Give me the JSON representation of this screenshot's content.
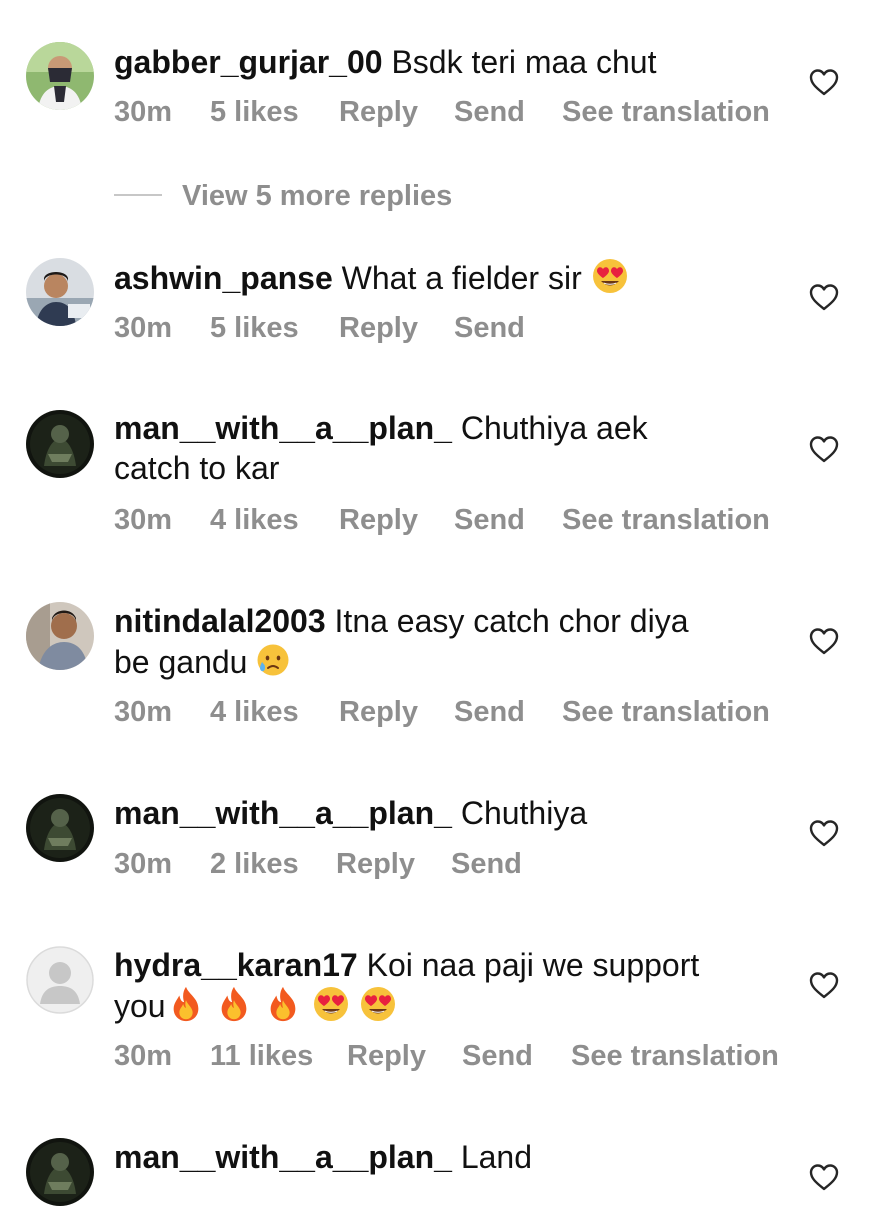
{
  "comments": [
    {
      "username": "gabber_gurjar_00",
      "text": "Bsdk teri maa chut",
      "time": "30m",
      "likes": "5 likes",
      "reply": "Reply",
      "send": "Send",
      "translation": "See translation"
    },
    {
      "username": "ashwin_panse",
      "text": "What a fielder sir",
      "emoji": "heart-eyes",
      "time": "30m",
      "likes": "5 likes",
      "reply": "Reply",
      "send": "Send"
    },
    {
      "username": "man__with__a__plan_",
      "text_line1": "Chuthiya aek",
      "text_line2": "catch to kar",
      "time": "30m",
      "likes": "4 likes",
      "reply": "Reply",
      "send": "Send",
      "translation": "See translation"
    },
    {
      "username": "nitindalal2003",
      "text_line1": "Itna easy catch chor diya",
      "text_line2": "be gandu",
      "emoji": "sad-tear",
      "time": "30m",
      "likes": "4 likes",
      "reply": "Reply",
      "send": "Send",
      "translation": "See translation"
    },
    {
      "username": "man__with__a__plan_",
      "text": "Chuthiya",
      "time": "30m",
      "likes": "2 likes",
      "reply": "Reply",
      "send": "Send"
    },
    {
      "username": "hydra__karan17",
      "text_line1": "Koi naa paji we support",
      "text_line2": "you",
      "emojis": [
        "fire",
        "fire",
        "fire",
        "heart-eyes",
        "heart-eyes"
      ],
      "time": "30m",
      "likes": "11 likes",
      "reply": "Reply",
      "send": "Send",
      "translation": "See translation"
    },
    {
      "username": "man__with__a__plan_",
      "text": "Land"
    }
  ],
  "view_more_replies": "View 5 more replies",
  "colors": {
    "text": "#111111",
    "meta": "#8e8e8e",
    "divider": "#c7c7c7"
  },
  "icons": {
    "like": "heart-outline-icon"
  }
}
